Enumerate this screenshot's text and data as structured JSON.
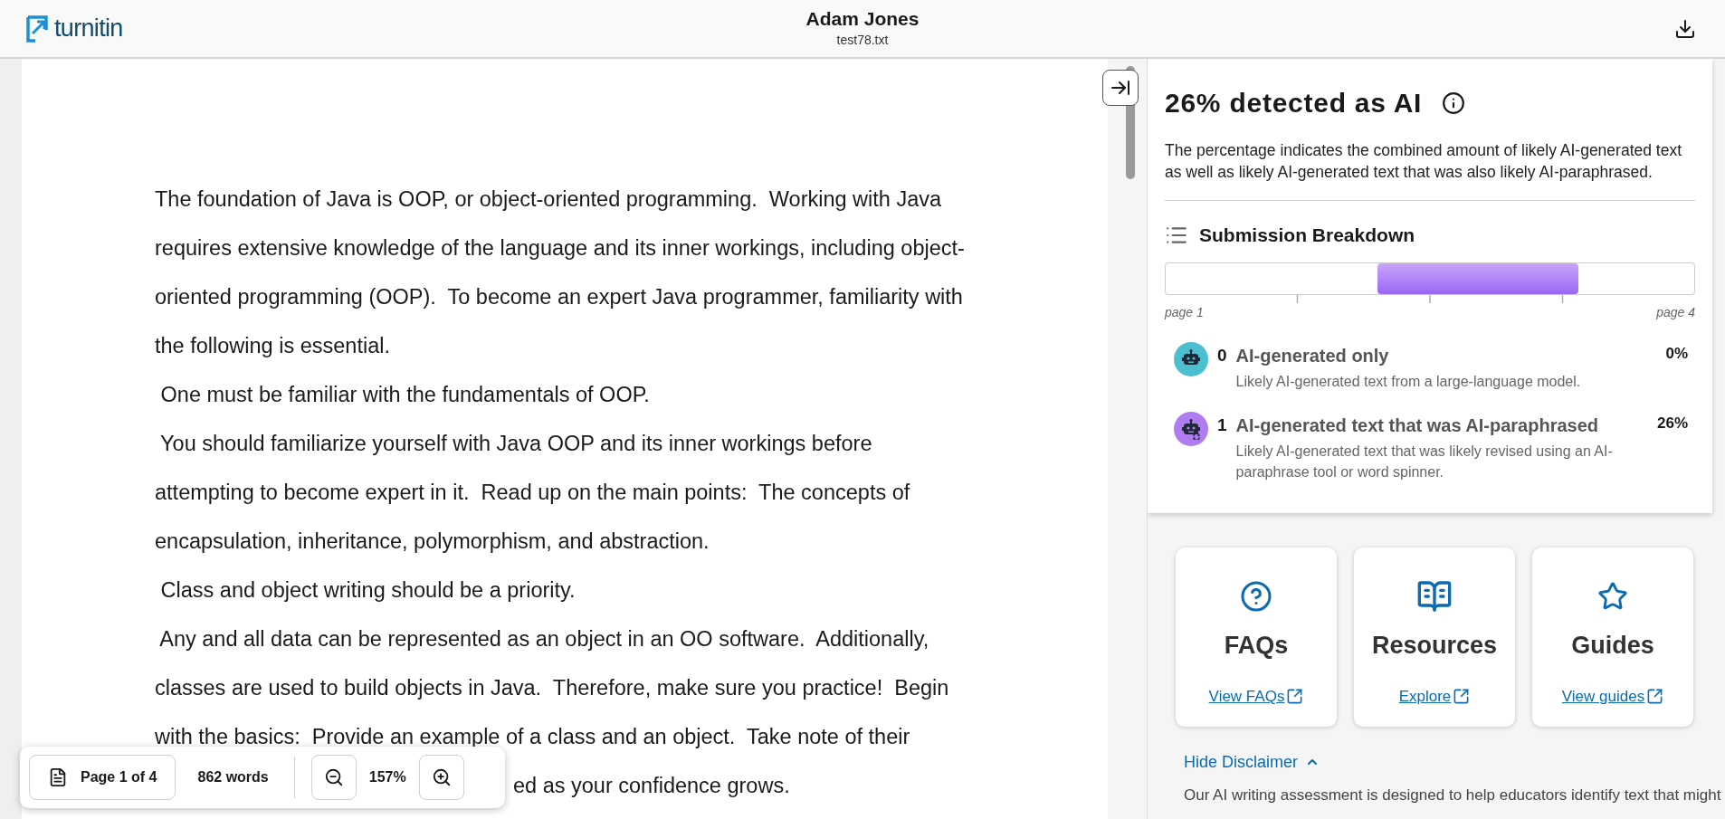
{
  "header": {
    "logo": "turnitin",
    "title": "Adam Jones",
    "subtitle": "test78.txt"
  },
  "document": {
    "lines": [
      {
        "text": "The foundation of Java is OOP, or object-oriented programming.  Working with Java",
        "kind": "full"
      },
      {
        "text": "requires extensive knowledge of the language and its inner workings, including object-",
        "kind": "full"
      },
      {
        "text": "oriented programming (OOP).  To become an expert Java programmer, familiarity with",
        "kind": "full"
      },
      {
        "text": "the following is essential.",
        "kind": "full"
      },
      {
        "text": " One must be familiar with the fundamentals of OOP.",
        "kind": "full"
      },
      {
        "text": " You should familiarize yourself with Java OOP and its inner workings before",
        "kind": "full"
      },
      {
        "text": "attempting to become expert in it.  Read up on the main points:  The concepts of",
        "kind": "full"
      },
      {
        "text": "encapsulation, inheritance, polymorphism, and abstraction.",
        "kind": "full"
      },
      {
        "text": " Class and object writing should be a priority.",
        "kind": "full"
      },
      {
        "text": " Any and all data can be represented as an object in an OO software.  Additionally,",
        "kind": "full"
      },
      {
        "text": "classes are used to build objects in Java.  Therefore, make sure you practice!  Begin",
        "kind": "full"
      },
      {
        "text": "with the basics:  Provide an example of a class and an object.  Take note of their",
        "kind": "full"
      },
      {
        "text": "ed as your confidence grows.",
        "kind": "covered"
      }
    ]
  },
  "toolbar": {
    "page": "Page 1 of 4",
    "words": "862 words",
    "zoom": "157%"
  },
  "panel": {
    "title": "26% detected as AI",
    "description": "The percentage indicates the combined amount of likely AI-generated text as well as likely AI-generated text that was also likely AI-paraphrased.",
    "breakdown_title": "Submission Breakdown",
    "start_label": "page 1",
    "end_label": "page 4",
    "categories": [
      {
        "kind": "generated",
        "count": "0",
        "name": "AI-generated only",
        "description": "Likely AI-generated text from a large-language model.",
        "percent": "0%",
        "color": "#4bbfcf"
      },
      {
        "kind": "paraphrased",
        "count": "1",
        "name": "AI-generated text that was AI-paraphrased",
        "description": "Likely AI-generated text that was likely revised using an AI-paraphrase tool or word spinner.",
        "percent": "26%",
        "color": "#b07cf0"
      }
    ]
  },
  "resources": [
    {
      "kind": "faq",
      "title": "FAQs",
      "link": "View FAQs"
    },
    {
      "kind": "resources",
      "title": "Resources",
      "link": "Explore"
    },
    {
      "kind": "guides",
      "title": "Guides",
      "link": "View guides"
    }
  ],
  "disclaimer": {
    "toggle": "Hide Disclaimer",
    "expanded": true,
    "text": "Our AI writing assessment is designed to help educators identify text that might"
  }
}
